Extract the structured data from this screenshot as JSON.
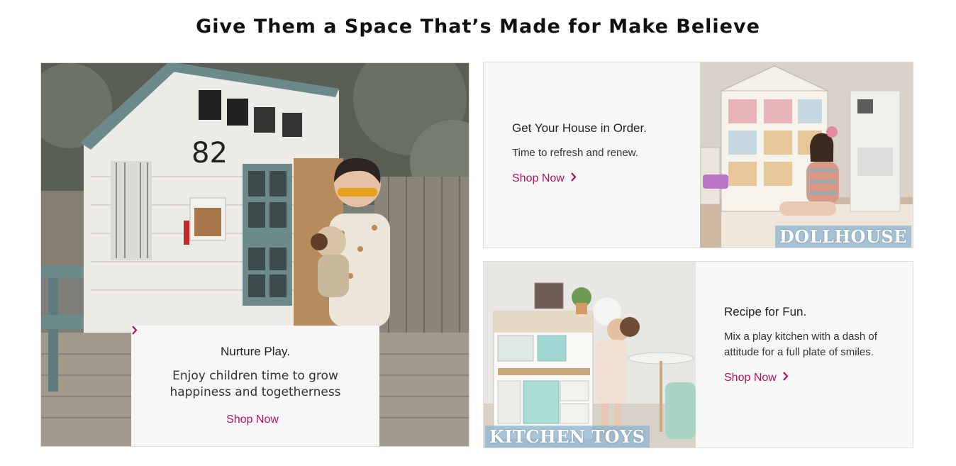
{
  "header": {
    "title": "Give Them a Space That’s Made for Make Believe"
  },
  "hero": {
    "title": "Nurture Play.",
    "text": "Enjoy children time to grow happiness and togetherness",
    "cta": "Shop Now",
    "house_number": "82"
  },
  "cards": [
    {
      "title": "Get Your House in Order.",
      "text": "Time to refresh and renew.",
      "cta": "Shop Now",
      "image_label": "DOLLHOUSE"
    },
    {
      "title": "Recipe for Fun.",
      "text": "Mix a play kitchen with a dash of attitude for a full plate of smiles.",
      "cta": "Shop Now",
      "image_label": "KITCHEN TOYS"
    }
  ],
  "icons": {
    "chevron": "chevron-right-icon"
  },
  "colors": {
    "accent": "#b0145f",
    "card_bg": "#f7f7f7",
    "label_bg": "#8cb4d2"
  }
}
